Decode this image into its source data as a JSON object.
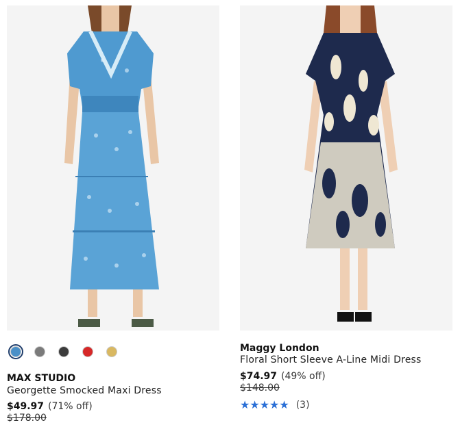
{
  "products": [
    {
      "brand": "MAX STUDIO",
      "title": "Georgette Smocked Maxi Dress",
      "price": "$49.97",
      "discount": "(71% off)",
      "original_price": "$178.00",
      "image_icon": "dress-photo-blue-print",
      "swatches": [
        {
          "name": "blue-print-swatch",
          "color": "#4a90c8",
          "selected": true
        },
        {
          "name": "grey-print-swatch",
          "color": "#7b7b7b",
          "selected": false
        },
        {
          "name": "black-print-swatch",
          "color": "#3c3c3c",
          "selected": false
        },
        {
          "name": "red-print-swatch",
          "color": "#d62828",
          "selected": false
        },
        {
          "name": "gold-print-swatch",
          "color": "#d9b861",
          "selected": false
        }
      ]
    },
    {
      "brand": "Maggy London",
      "title": "Floral Short Sleeve A-Line Midi Dress",
      "price": "$74.97",
      "discount": "(49% off)",
      "original_price": "$148.00",
      "image_icon": "dress-photo-navy-floral",
      "rating": {
        "stars_display": "★★★★★",
        "stars_value": 4.5,
        "count": "(3)",
        "color": "#2a6fd6"
      }
    }
  ]
}
